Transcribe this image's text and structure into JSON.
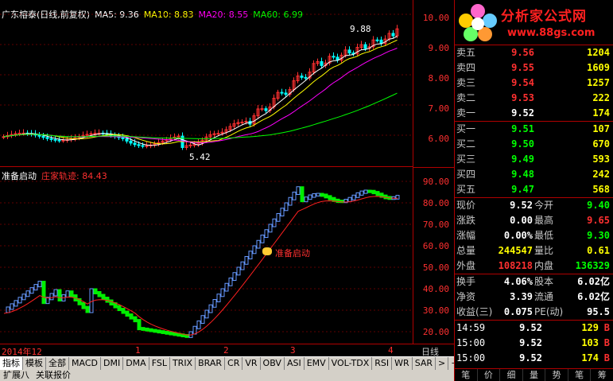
{
  "legend": {
    "stock": "广东榕泰(日线,前复权)",
    "ma5": "MA5: 9.36",
    "ma10": "MA10: 8.83",
    "ma20": "MA20: 8.55",
    "ma60": "MA60: 6.99"
  },
  "colors": {
    "ma5": "#ffffff",
    "ma10": "#ffff00",
    "ma20": "#ff00ff",
    "ma60": "#00ff00",
    "up": "#ff3030",
    "down": "#00ffff",
    "bar_up": "#6699ff",
    "bar_down": "#00ee00"
  },
  "annotations": {
    "high": "9.88",
    "low": "5.42",
    "signal": "准备启动"
  },
  "main_axis": [
    "10.00",
    "9.00",
    "8.00",
    "7.00",
    "6.00"
  ],
  "ind_legend": {
    "name": "准备启动",
    "series": "庄家轨迹: 84.43"
  },
  "ind_axis": [
    "90.00",
    "80.00",
    "70.00",
    "60.00",
    "50.00",
    "40.00",
    "30.00",
    "20.00"
  ],
  "dates": [
    "2014年12",
    "1",
    "2",
    "3",
    "4"
  ],
  "period_label": "日线",
  "logo": {
    "title": "分析家公式网",
    "url": "www.88gs.com"
  },
  "orderbook": [
    {
      "label": "卖五",
      "price": "9.56",
      "vol": "1204"
    },
    {
      "label": "卖四",
      "price": "9.55",
      "vol": "1609"
    },
    {
      "label": "卖三",
      "price": "9.54",
      "vol": "1257"
    },
    {
      "label": "卖二",
      "price": "9.53",
      "vol": "222"
    },
    {
      "label": "卖一",
      "price": "9.52",
      "vol": "174"
    },
    {
      "label": "买一",
      "price": "9.51",
      "vol": "107"
    },
    {
      "label": "买二",
      "price": "9.50",
      "vol": "670"
    },
    {
      "label": "买三",
      "price": "9.49",
      "vol": "593"
    },
    {
      "label": "买四",
      "price": "9.48",
      "vol": "242"
    },
    {
      "label": "买五",
      "price": "9.47",
      "vol": "568"
    }
  ],
  "stats": [
    {
      "l1": "现价",
      "v1": "9.52",
      "l2": "今开",
      "v2": "9.40"
    },
    {
      "l1": "涨跌",
      "v1": "0.00",
      "l2": "最高",
      "v2": "9.65"
    },
    {
      "l1": "涨幅",
      "v1": "0.00%",
      "l2": "最低",
      "v2": "9.30"
    },
    {
      "l1": "总量",
      "v1": "244547",
      "l2": "量比",
      "v2": "0.61"
    },
    {
      "l1": "外盘",
      "v1": "108218",
      "l2": "内盘",
      "v2": "136329"
    }
  ],
  "stats2": [
    {
      "l1": "换手",
      "v1": "4.06%",
      "l2": "股本",
      "v2": "6.02亿"
    },
    {
      "l1": "净资",
      "v1": "3.39",
      "l2": "流通",
      "v2": "6.02亿"
    },
    {
      "l1": "收益(三)",
      "v1": "0.075",
      "l2": "PE(动)",
      "v2": "95.5"
    }
  ],
  "trades": [
    {
      "time": "14:59",
      "price": "9.52",
      "qty": "129",
      "side": "B"
    },
    {
      "time": "15:00",
      "price": "9.52",
      "qty": "103",
      "side": "B"
    },
    {
      "time": "15:00",
      "price": "9.52",
      "qty": "174",
      "side": "B"
    }
  ],
  "quote_tabs": [
    "笔",
    "价",
    "细",
    "量",
    "势",
    "笔",
    "筹"
  ],
  "toolbar": [
    "指标",
    "模板",
    "全部",
    "MACD",
    "DMI",
    "DMA",
    "FSL",
    "TRIX",
    "BRAR",
    "CR",
    "VR",
    "OBV",
    "ASI",
    "EMV",
    "VOL-TDX",
    "RSI",
    "WR",
    "SAR",
    ">",
    "+",
    "−",
    "□"
  ],
  "toolbar2": [
    "扩展八",
    "关联报价"
  ]
}
